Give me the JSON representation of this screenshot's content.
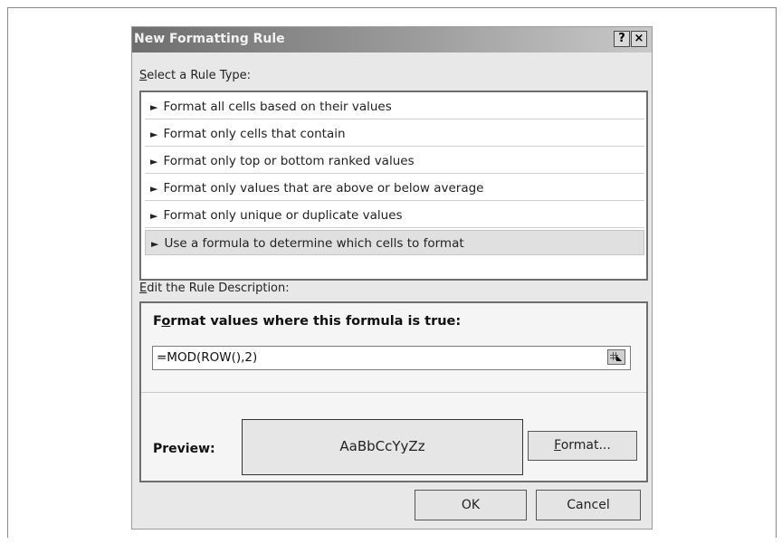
{
  "dialog": {
    "title": "New Formatting Rule",
    "help_button": "?",
    "close_button": "×"
  },
  "rule_type": {
    "label_accel": "S",
    "label_rest": "elect a Rule Type:",
    "items": [
      {
        "label": "Format all cells based on their values"
      },
      {
        "label": "Format only cells that contain"
      },
      {
        "label": "Format only top or bottom ranked values"
      },
      {
        "label": "Format only values that are above or below average"
      },
      {
        "label": "Format only unique or duplicate values"
      },
      {
        "label": "Use a formula to determine which cells to format",
        "selected": true
      }
    ]
  },
  "description": {
    "label_accel": "E",
    "label_rest": "dit the Rule Description:",
    "heading_pre": "F",
    "heading_accel": "o",
    "heading_rest": "rmat values where this formula is true:",
    "formula_value": "=MOD(ROW(),2)",
    "range_icon": "range-select-icon",
    "preview_label": "Preview:",
    "preview_sample": "AaBbCcYyZz",
    "format_accel": "F",
    "format_rest": "ormat..."
  },
  "buttons": {
    "ok": "OK",
    "cancel": "Cancel"
  },
  "arrow_glyph": "►"
}
